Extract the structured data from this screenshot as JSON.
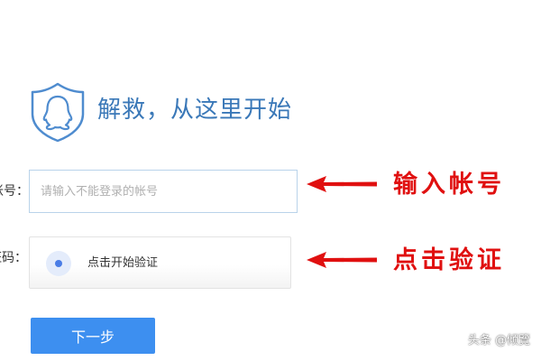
{
  "header": {
    "logo_icon": "qq-shield-icon",
    "title": "解救，从这里开始"
  },
  "form": {
    "account_label": "帐号：",
    "account_placeholder": "请输入不能登录的帐号",
    "account_value": "",
    "captcha_label": "验证码：",
    "captcha_prompt": "点击开始验证",
    "next_button": "下一步"
  },
  "annotations": {
    "account_note": "输入帐号",
    "captcha_note": "点击验证",
    "arrow_icon": "left-arrow-icon",
    "color": "#e01010"
  },
  "watermark": "头条 @倾覽",
  "colors": {
    "accent": "#3a78b8",
    "button": "#3d8ff0",
    "annotation": "#e01010"
  }
}
